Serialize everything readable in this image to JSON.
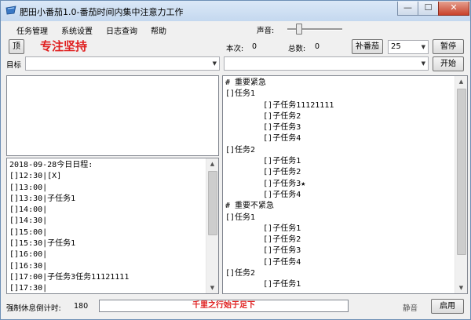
{
  "window": {
    "title": "肥田小番茄1.0-番茄时间内集中注意力工作",
    "minimize_glyph": "—",
    "maximize_glyph": "☐",
    "close_glyph": "✕"
  },
  "menu": [
    "任务管理",
    "系统设置",
    "日志查询",
    "帮助"
  ],
  "sound": {
    "label": "声音:",
    "level": 0.2
  },
  "toolbar": {
    "pin_label": "顶",
    "slogan": "专注坚持",
    "this_count_label": "本次:",
    "this_count_value": "0",
    "total_label": "总数:",
    "total_value": "0",
    "add_tomato_button": "补番茄",
    "minutes_value": "25",
    "pause_button": "暂停"
  },
  "goal_row": {
    "goal_label": "目标",
    "goal_value": "",
    "task_value": "",
    "start_button": "开始"
  },
  "schedule_lines": [
    "2018-09-28今日日程:",
    "[]12:30|[X]",
    "[]13:00|",
    "[]13:30|子任务1",
    "[]14:00|",
    "[]14:30|",
    "[]15:00|",
    "[]15:30|子任务1",
    "[]16:00|",
    "[]16:30|",
    "[]17:00|子任务3任务11121111",
    "[]17:30|"
  ],
  "task_lines": [
    "# 重要紧急",
    "[]任务1",
    "        []子任务11121111",
    "        []子任务2",
    "        []子任务3",
    "        []子任务4",
    "[]任务2",
    "        []子任务1",
    "        []子任务2",
    "        []子任务3★",
    "        []子任务4",
    "",
    "# 重要不紧急",
    "[]任务1",
    "        []子任务1",
    "        []子任务2",
    "        []子任务3",
    "        []子任务4",
    "[]任务2",
    "        []子任务1"
  ],
  "status": {
    "rest_label": "强制休息倒计时:",
    "rest_value": "180",
    "quote": "千里之行始于足下",
    "mode_label": "静音",
    "enable_button": "启用"
  }
}
